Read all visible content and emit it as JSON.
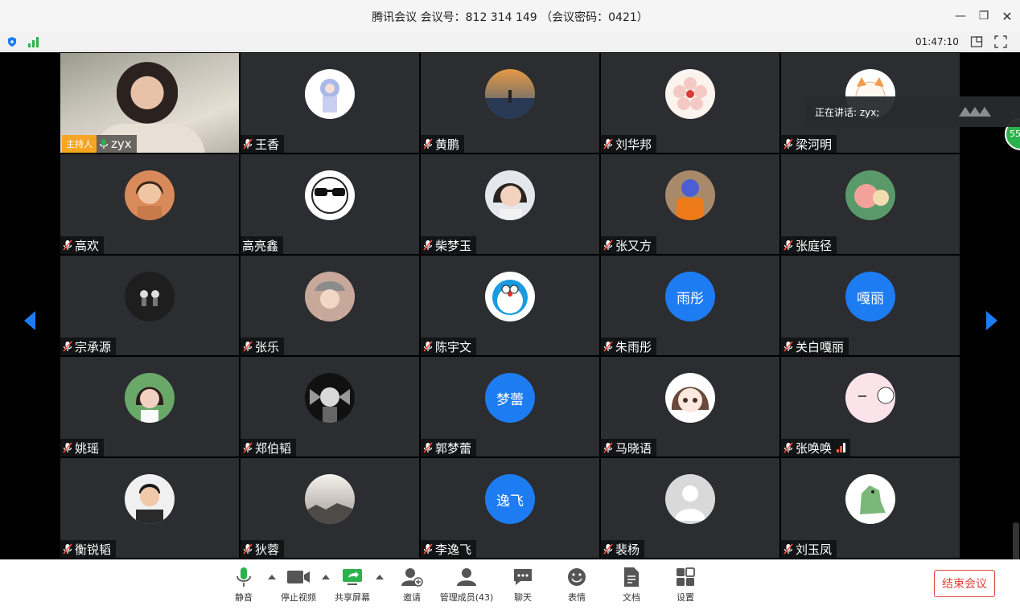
{
  "window": {
    "title": "腾讯会议 会议号：812 314 149 （会议密码：0421）"
  },
  "status": {
    "timer": "01:47:10"
  },
  "speaking": {
    "text": "正在讲话: zyx;",
    "badge": "55"
  },
  "host": {
    "badge": "主持人",
    "name": "zyx"
  },
  "participants": [
    {
      "name": "王香",
      "avatar": "anime-girl-blue"
    },
    {
      "name": "黄鹏",
      "avatar": "sunset-photo"
    },
    {
      "name": "刘华邦",
      "avatar": "flower-photo"
    },
    {
      "name": "梁河明",
      "avatar": "cartoon-cat"
    },
    {
      "name": "高欢",
      "avatar": "woman-photo"
    },
    {
      "name": "高亮鑫",
      "avatar": "sunglasses-cartoon"
    },
    {
      "name": "柴梦玉",
      "avatar": "girl-photo"
    },
    {
      "name": "张又方",
      "avatar": "orange-shirt-photo"
    },
    {
      "name": "张庭径",
      "avatar": "cartoon-pink"
    },
    {
      "name": "宗承源",
      "avatar": "dark-figures"
    },
    {
      "name": "张乐",
      "avatar": "hat-girl-photo"
    },
    {
      "name": "陈宇文",
      "avatar": "doraemon"
    },
    {
      "name": "朱雨彤",
      "avatar_text": "雨彤"
    },
    {
      "name": "关白嘎丽",
      "avatar_text": "嘎丽"
    },
    {
      "name": "姚瑶",
      "avatar": "girl-leaves-photo"
    },
    {
      "name": "郑伯韬",
      "avatar": "anime-dark"
    },
    {
      "name": "郭梦蕾",
      "avatar_text": "梦蕾"
    },
    {
      "name": "马晓语",
      "avatar": "anime-girl-brown"
    },
    {
      "name": "张唤唤",
      "avatar": "pink-cartoon"
    },
    {
      "name": "衡锐韬",
      "avatar": "man-photo"
    },
    {
      "name": "狄蓉",
      "avatar": "landscape-photo"
    },
    {
      "name": "李逸飞",
      "avatar_text": "逸飞"
    },
    {
      "name": "裴杨",
      "avatar": "default-person"
    },
    {
      "name": "刘玉凤",
      "avatar": "dinosaur-cartoon"
    }
  ],
  "toolbar": {
    "mute": "静音",
    "stop_video": "停止视频",
    "share_screen": "共享屏幕",
    "invite": "邀请",
    "manage_members": "管理成员(43)",
    "chat": "聊天",
    "reactions": "表情",
    "docs": "文档",
    "settings": "设置",
    "end_meeting": "结束会议"
  },
  "colors": {
    "accent": "#1d7cf2",
    "host_badge": "#f5a623",
    "end_button": "#e0433b",
    "signal_green": "#2bb24c"
  }
}
